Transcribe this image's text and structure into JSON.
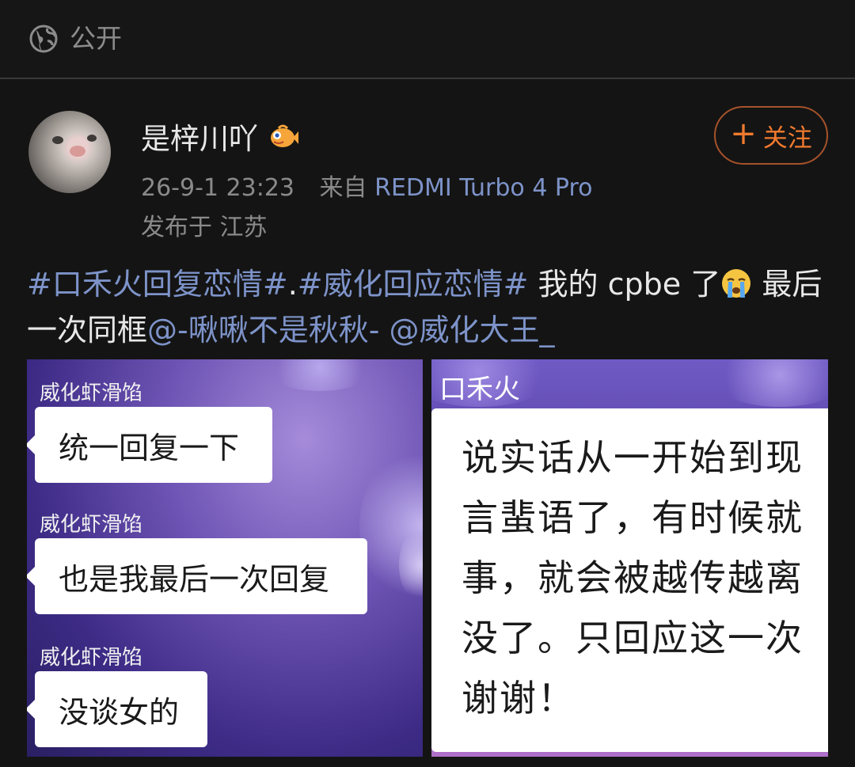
{
  "topbar": {
    "visibility": "公开",
    "icon": "globe-icon"
  },
  "author": {
    "name": "是梓川吖",
    "badge_icon": "fish-emoji-icon",
    "time": "26-9-1 23:23",
    "from_prefix": "来自",
    "device": "REDMI Turbo 4 Pro",
    "location": "发布于 江苏"
  },
  "follow": {
    "plus": "+",
    "label": "关注"
  },
  "post": {
    "tag1": "#口禾火回复恋情#",
    "dot": ".",
    "tag2": "#威化回应恋情#",
    "text1": " 我的 cpbe 了",
    "emoji": "crying-face-emoji",
    "text2": " 最后一次同框",
    "mention1": "@-啾啾不是秋秋-",
    "space": " ",
    "mention2": "@威化大王_"
  },
  "image1": {
    "messages": [
      {
        "sender": "威化虾滑馅",
        "text": "统一回复一下"
      },
      {
        "sender": "威化虾滑馅",
        "text": "也是我最后一次回复"
      },
      {
        "sender": "威化虾滑馅",
        "text": "没谈女的"
      }
    ]
  },
  "image2": {
    "sender": "口禾火",
    "lines": [
      "说实话从一开始到现",
      "言蜚语了，有时候就",
      "事，就会被越传越离",
      "没了。只回应这一次",
      "谢谢！"
    ]
  },
  "colors": {
    "accent_link": "#7d93c9",
    "follow_orange": "#f07a2e",
    "background": "#141414"
  }
}
